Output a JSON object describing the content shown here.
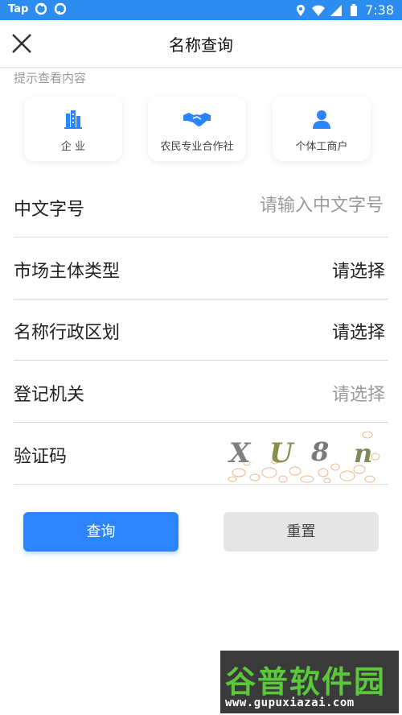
{
  "status_bar": {
    "left_text": "Tap",
    "time": "7:38",
    "icons": [
      "sync-icon",
      "sync-icon",
      "location-icon",
      "wifi-icon",
      "signal-icon",
      "battery-icon"
    ]
  },
  "header": {
    "title": "名称查询",
    "close_icon": "close-icon"
  },
  "hint": "提示查看内容",
  "categories": [
    {
      "label": "企 业",
      "icon": "building-icon"
    },
    {
      "label": "农民专业合作社",
      "icon": "handshake-icon"
    },
    {
      "label": "个体工商户",
      "icon": "person-icon"
    }
  ],
  "form": {
    "name_field": {
      "label": "中文字号",
      "placeholder": "请输入中文字号"
    },
    "market_type": {
      "label": "市场主体类型",
      "value": "请选择"
    },
    "region": {
      "label": "名称行政区划",
      "value": "请选择"
    },
    "authority": {
      "label": "登记机关",
      "value": "请选择"
    },
    "captcha": {
      "label": "验证码",
      "code": [
        "X",
        "U",
        "8",
        "n"
      ]
    }
  },
  "buttons": {
    "query": "查询",
    "reset": "重置"
  },
  "watermark": {
    "title": "谷普软件园",
    "url": "www.gupuxiazai.com"
  },
  "colors": {
    "status_bar": "#2d8cf0",
    "primary": "#2d84ff",
    "reset_bg": "#e5e5e5",
    "watermark_green": "#5ac83a"
  }
}
